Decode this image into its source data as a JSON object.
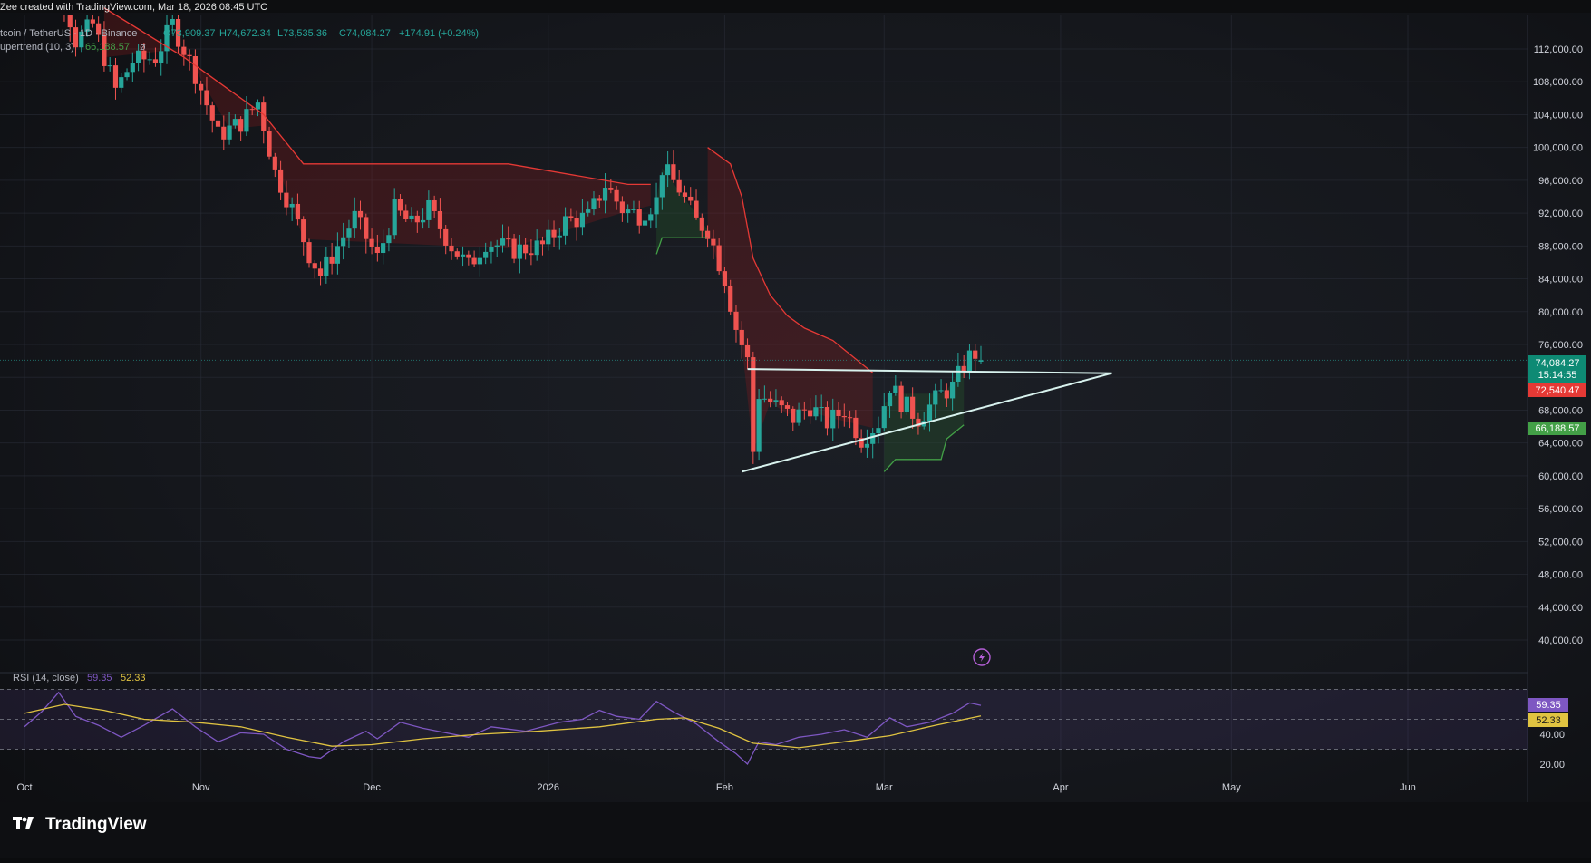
{
  "watermark": "Zee created with TradingView.com, Mar 18, 2026 08:45 UTC",
  "header": {
    "symbol": "tcoin / TetherUS · 1D · Binance",
    "open": "O73,909.37",
    "high": "H74,672.34",
    "low": "L73,535.36",
    "close": "C74,084.27",
    "change": "+174.91 (+0.24%)",
    "supertrend_label": "upertrend (10, 3)",
    "supertrend_value": "66,188.57"
  },
  "price_badges": {
    "last_price": "74,084.27",
    "countdown": "15:14:55",
    "supertrend_red": "72,540.47",
    "supertrend_green": "66,188.57"
  },
  "rsi": {
    "label": "RSI (14, close)",
    "value": "59.35",
    "ma_value": "52.33",
    "tick_labels": [
      "40.00",
      "20.00"
    ]
  },
  "brand": {
    "name": "TradingView"
  },
  "colors": {
    "up": "#26a69a",
    "down": "#ef5350",
    "rsi_line": "#7e57c2",
    "rsi_ma": "#e0c341",
    "trendline": "#d8f2ee",
    "supertrend_up": "#43a047",
    "supertrend_down": "#e53935"
  },
  "chart_data": {
    "type": "candlestick",
    "price_axis": {
      "ticks": [
        112000,
        108000,
        104000,
        100000,
        96000,
        92000,
        88000,
        84000,
        80000,
        76000,
        72000,
        68000,
        64000,
        60000,
        56000,
        52000,
        48000,
        44000,
        40000
      ],
      "tick_labels": [
        "112,000.00",
        "108,000.00",
        "104,000.00",
        "100,000.00",
        "96,000.00",
        "92,000.00",
        "88,000.00",
        "84,000.00",
        "80,000.00",
        "76,000.00",
        "72,000.00",
        "68,000.00",
        "64,000.00",
        "60,000.00",
        "56,000.00",
        "52,000.00",
        "48,000.00",
        "44,000.00",
        "40,000.00"
      ],
      "ylim": [
        36000,
        116500
      ]
    },
    "time_axis": {
      "labels": [
        {
          "text": "Oct",
          "date": "2025-10-01"
        },
        {
          "text": "Nov",
          "date": "2025-11-01"
        },
        {
          "text": "Dec",
          "date": "2025-12-01"
        },
        {
          "text": "2026",
          "date": "2026-01-01"
        },
        {
          "text": "Feb",
          "date": "2026-02-01"
        },
        {
          "text": "Mar",
          "date": "2026-03-01"
        },
        {
          "text": "Apr",
          "date": "2026-04-01"
        },
        {
          "text": "May",
          "date": "2026-05-01"
        },
        {
          "text": "Jun",
          "date": "2026-06-01"
        }
      ]
    },
    "close_path": [
      [
        "2025-10-01",
        117500
      ],
      [
        "2025-10-06",
        123500
      ],
      [
        "2025-10-10",
        113000
      ],
      [
        "2025-10-13",
        115000
      ],
      [
        "2025-10-17",
        107000
      ],
      [
        "2025-10-20",
        110500
      ],
      [
        "2025-10-24",
        111000
      ],
      [
        "2025-10-27",
        115000
      ],
      [
        "2025-10-31",
        109000
      ],
      [
        "2025-11-04",
        101500
      ],
      [
        "2025-11-08",
        103000
      ],
      [
        "2025-11-11",
        105500
      ],
      [
        "2025-11-14",
        97000
      ],
      [
        "2025-11-17",
        92500
      ],
      [
        "2025-11-20",
        87000
      ],
      [
        "2025-11-22",
        84500
      ],
      [
        "2025-11-25",
        88000
      ],
      [
        "2025-11-28",
        91500
      ],
      [
        "2025-12-02",
        86500
      ],
      [
        "2025-12-05",
        92500
      ],
      [
        "2025-12-08",
        90500
      ],
      [
        "2025-12-11",
        92500
      ],
      [
        "2025-12-15",
        88000
      ],
      [
        "2025-12-18",
        85500
      ],
      [
        "2025-12-21",
        88500
      ],
      [
        "2025-12-26",
        87500
      ],
      [
        "2025-12-31",
        88000
      ],
      [
        "2026-01-04",
        91000
      ],
      [
        "2026-01-08",
        91500
      ],
      [
        "2026-01-11",
        95500
      ],
      [
        "2026-01-14",
        92500
      ],
      [
        "2026-01-17",
        91800
      ],
      [
        "2026-01-20",
        93500
      ],
      [
        "2026-01-21",
        97500
      ],
      [
        "2026-01-24",
        95000
      ],
      [
        "2026-01-27",
        91000
      ],
      [
        "2026-01-29",
        90000
      ],
      [
        "2026-02-01",
        84000
      ],
      [
        "2026-02-03",
        78000
      ],
      [
        "2026-02-05",
        74000
      ],
      [
        "2026-02-06",
        63000
      ],
      [
        "2026-02-07",
        70000
      ],
      [
        "2026-02-10",
        68500
      ],
      [
        "2026-02-13",
        67000
      ],
      [
        "2026-02-16",
        68500
      ],
      [
        "2026-02-19",
        66500
      ],
      [
        "2026-02-22",
        68000
      ],
      [
        "2026-02-25",
        64500
      ],
      [
        "2026-02-28",
        66500
      ],
      [
        "2026-03-02",
        71000
      ],
      [
        "2026-03-04",
        69000
      ],
      [
        "2026-03-07",
        67000
      ],
      [
        "2026-03-09",
        68500
      ],
      [
        "2026-03-11",
        70000
      ],
      [
        "2026-03-13",
        70800
      ],
      [
        "2026-03-15",
        73500
      ],
      [
        "2026-03-16",
        74500
      ],
      [
        "2026-03-17",
        74909
      ],
      [
        "2026-03-18",
        74084
      ]
    ],
    "supertrend": {
      "down": [
        [
          "2025-10-15",
          117000
        ],
        [
          "2025-10-29",
          111000
        ],
        [
          "2025-11-06",
          107000
        ],
        [
          "2025-11-12",
          104000
        ],
        [
          "2025-11-19",
          98000
        ],
        [
          "2025-12-25",
          98000
        ],
        [
          "2026-01-15",
          95500
        ],
        [
          "2026-01-19",
          95500
        ]
      ],
      "up": [
        [
          "2026-01-20",
          87000
        ],
        [
          "2026-01-21",
          89000
        ],
        [
          "2026-01-29",
          89000
        ]
      ],
      "down2": [
        [
          "2026-01-29",
          100000
        ],
        [
          "2026-02-02",
          98000
        ],
        [
          "2026-02-04",
          94000
        ],
        [
          "2026-02-06",
          86500
        ],
        [
          "2026-02-09",
          82000
        ],
        [
          "2026-02-12",
          79500
        ],
        [
          "2026-02-15",
          78000
        ],
        [
          "2026-02-20",
          76500
        ],
        [
          "2026-02-27",
          72540
        ]
      ],
      "up2": [
        [
          "2026-03-01",
          60500
        ],
        [
          "2026-03-03",
          62000
        ],
        [
          "2026-03-11",
          62000
        ],
        [
          "2026-03-12",
          64500
        ],
        [
          "2026-03-15",
          66189
        ]
      ]
    },
    "pattern": {
      "type": "ascending triangle",
      "resistance": [
        [
          "2026-02-05",
          73000
        ],
        [
          "2026-04-10",
          72500
        ]
      ],
      "support": [
        [
          "2026-02-04",
          60500
        ],
        [
          "2026-04-10",
          72500
        ]
      ]
    },
    "rsi_axis": {
      "ylim": [
        15,
        90
      ],
      "bands": [
        70,
        50,
        30
      ]
    },
    "rsi_series": [
      [
        "2025-10-01",
        45
      ],
      [
        "2025-10-04",
        55
      ],
      [
        "2025-10-07",
        68
      ],
      [
        "2025-10-10",
        52
      ],
      [
        "2025-10-14",
        46
      ],
      [
        "2025-10-18",
        38
      ],
      [
        "2025-10-22",
        46
      ],
      [
        "2025-10-27",
        57
      ],
      [
        "2025-10-31",
        45
      ],
      [
        "2025-11-04",
        35
      ],
      [
        "2025-11-08",
        41
      ],
      [
        "2025-11-12",
        40
      ],
      [
        "2025-11-16",
        30
      ],
      [
        "2025-11-20",
        25
      ],
      [
        "2025-11-22",
        24
      ],
      [
        "2025-11-26",
        35
      ],
      [
        "2025-11-30",
        42
      ],
      [
        "2025-12-02",
        37
      ],
      [
        "2025-12-06",
        48
      ],
      [
        "2025-12-10",
        44
      ],
      [
        "2025-12-14",
        41
      ],
      [
        "2025-12-18",
        38
      ],
      [
        "2025-12-22",
        45
      ],
      [
        "2025-12-28",
        42
      ],
      [
        "2026-01-03",
        48
      ],
      [
        "2026-01-07",
        50
      ],
      [
        "2026-01-10",
        56
      ],
      [
        "2026-01-13",
        52
      ],
      [
        "2026-01-17",
        50
      ],
      [
        "2026-01-20",
        62
      ],
      [
        "2026-01-23",
        55
      ],
      [
        "2026-01-27",
        47
      ],
      [
        "2026-01-31",
        35
      ],
      [
        "2026-02-03",
        27
      ],
      [
        "2026-02-05",
        20
      ],
      [
        "2026-02-07",
        35
      ],
      [
        "2026-02-10",
        33
      ],
      [
        "2026-02-14",
        38
      ],
      [
        "2026-02-18",
        40
      ],
      [
        "2026-02-22",
        43
      ],
      [
        "2026-02-26",
        38
      ],
      [
        "2026-03-02",
        51
      ],
      [
        "2026-03-05",
        45
      ],
      [
        "2026-03-09",
        48
      ],
      [
        "2026-03-13",
        54
      ],
      [
        "2026-03-16",
        61
      ],
      [
        "2026-03-18",
        59.35
      ]
    ],
    "rsi_ma_series": [
      [
        "2025-10-01",
        54
      ],
      [
        "2025-10-08",
        60
      ],
      [
        "2025-10-15",
        56
      ],
      [
        "2025-10-22",
        50
      ],
      [
        "2025-10-31",
        48
      ],
      [
        "2025-11-08",
        45
      ],
      [
        "2025-11-16",
        38
      ],
      [
        "2025-11-24",
        32
      ],
      [
        "2025-12-01",
        33
      ],
      [
        "2025-12-10",
        37
      ],
      [
        "2025-12-20",
        40
      ],
      [
        "2025-12-30",
        42
      ],
      [
        "2026-01-10",
        45
      ],
      [
        "2026-01-20",
        50
      ],
      [
        "2026-01-25",
        51
      ],
      [
        "2026-01-31",
        44
      ],
      [
        "2026-02-06",
        34
      ],
      [
        "2026-02-14",
        31
      ],
      [
        "2026-02-22",
        35
      ],
      [
        "2026-03-02",
        39
      ],
      [
        "2026-03-10",
        46
      ],
      [
        "2026-03-18",
        52.33
      ]
    ]
  }
}
